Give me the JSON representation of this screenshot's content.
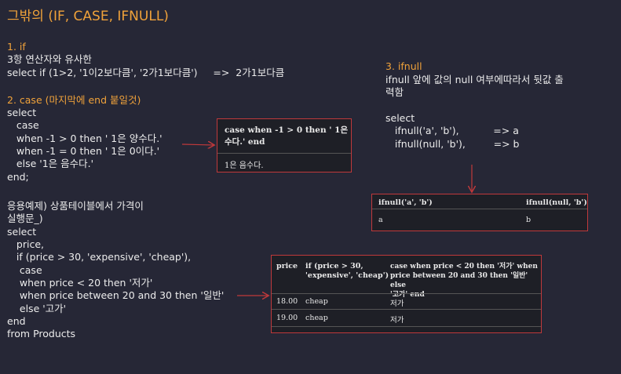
{
  "title": "그밖의 (IF, CASE, IFNULL)",
  "section1": {
    "heading": "1. if",
    "lines": [
      "3항 연산자와 유사한",
      "select if (1>2, '1이2보다큼', '2가1보다큼')     =>  2가1보다큼"
    ]
  },
  "section2": {
    "heading": "2. case (마지막에 end 붙일것)",
    "lines": [
      "select",
      "   case",
      "   when -1 > 0 then ' 1은 양수다.'",
      "   when -1 = 0 then ' 1은 0이다.'",
      "   else '1은 음수다.'",
      "end;"
    ]
  },
  "section_example": {
    "lines": [
      "응용예제) 상품테이블에서 가격이",
      "실행문_)",
      "select",
      "   price,",
      "   if (price > 30, 'expensive', 'cheap'),",
      "    case",
      "    when price < 20 then '저가'",
      "    when price between 20 and 30 then '일반'",
      "    else '고가'",
      "end",
      "from Products"
    ]
  },
  "section3": {
    "heading": "3. ifnull",
    "lines": [
      "ifnull 앞에 값의 null 여부에따라서 뒷값 출",
      "력함",
      "",
      "select",
      "   ifnull('a', 'b'),           => a",
      "   ifnull(null, 'b'),         => b"
    ]
  },
  "result_case": {
    "header_line1": "case when -1 > 0 then ' 1은",
    "header_line2": "수다.' end",
    "value": "1은 음수다."
  },
  "result_ifnull": {
    "col1": "ifnull('a', 'b')",
    "col2": "ifnull(null, 'b')",
    "val1": "a",
    "val2": "b"
  },
  "result_products": {
    "col1": "price",
    "col2_line1": "if (price > 30,",
    "col2_line2": "'expensive', 'cheap')",
    "col3_line1": "case when price < 20 then '저가' when",
    "col3_line2": "price between 20 and 30 then '일반' else",
    "col3_line3": "'고가' end",
    "rows": [
      {
        "price": "18.00",
        "flag": "cheap",
        "grade": "저가"
      },
      {
        "price": "19.00",
        "flag": "cheap",
        "grade": "저가"
      }
    ]
  },
  "colors": {
    "background": "#262736",
    "heading": "#f0a23a",
    "arrow": "#c0393b"
  }
}
